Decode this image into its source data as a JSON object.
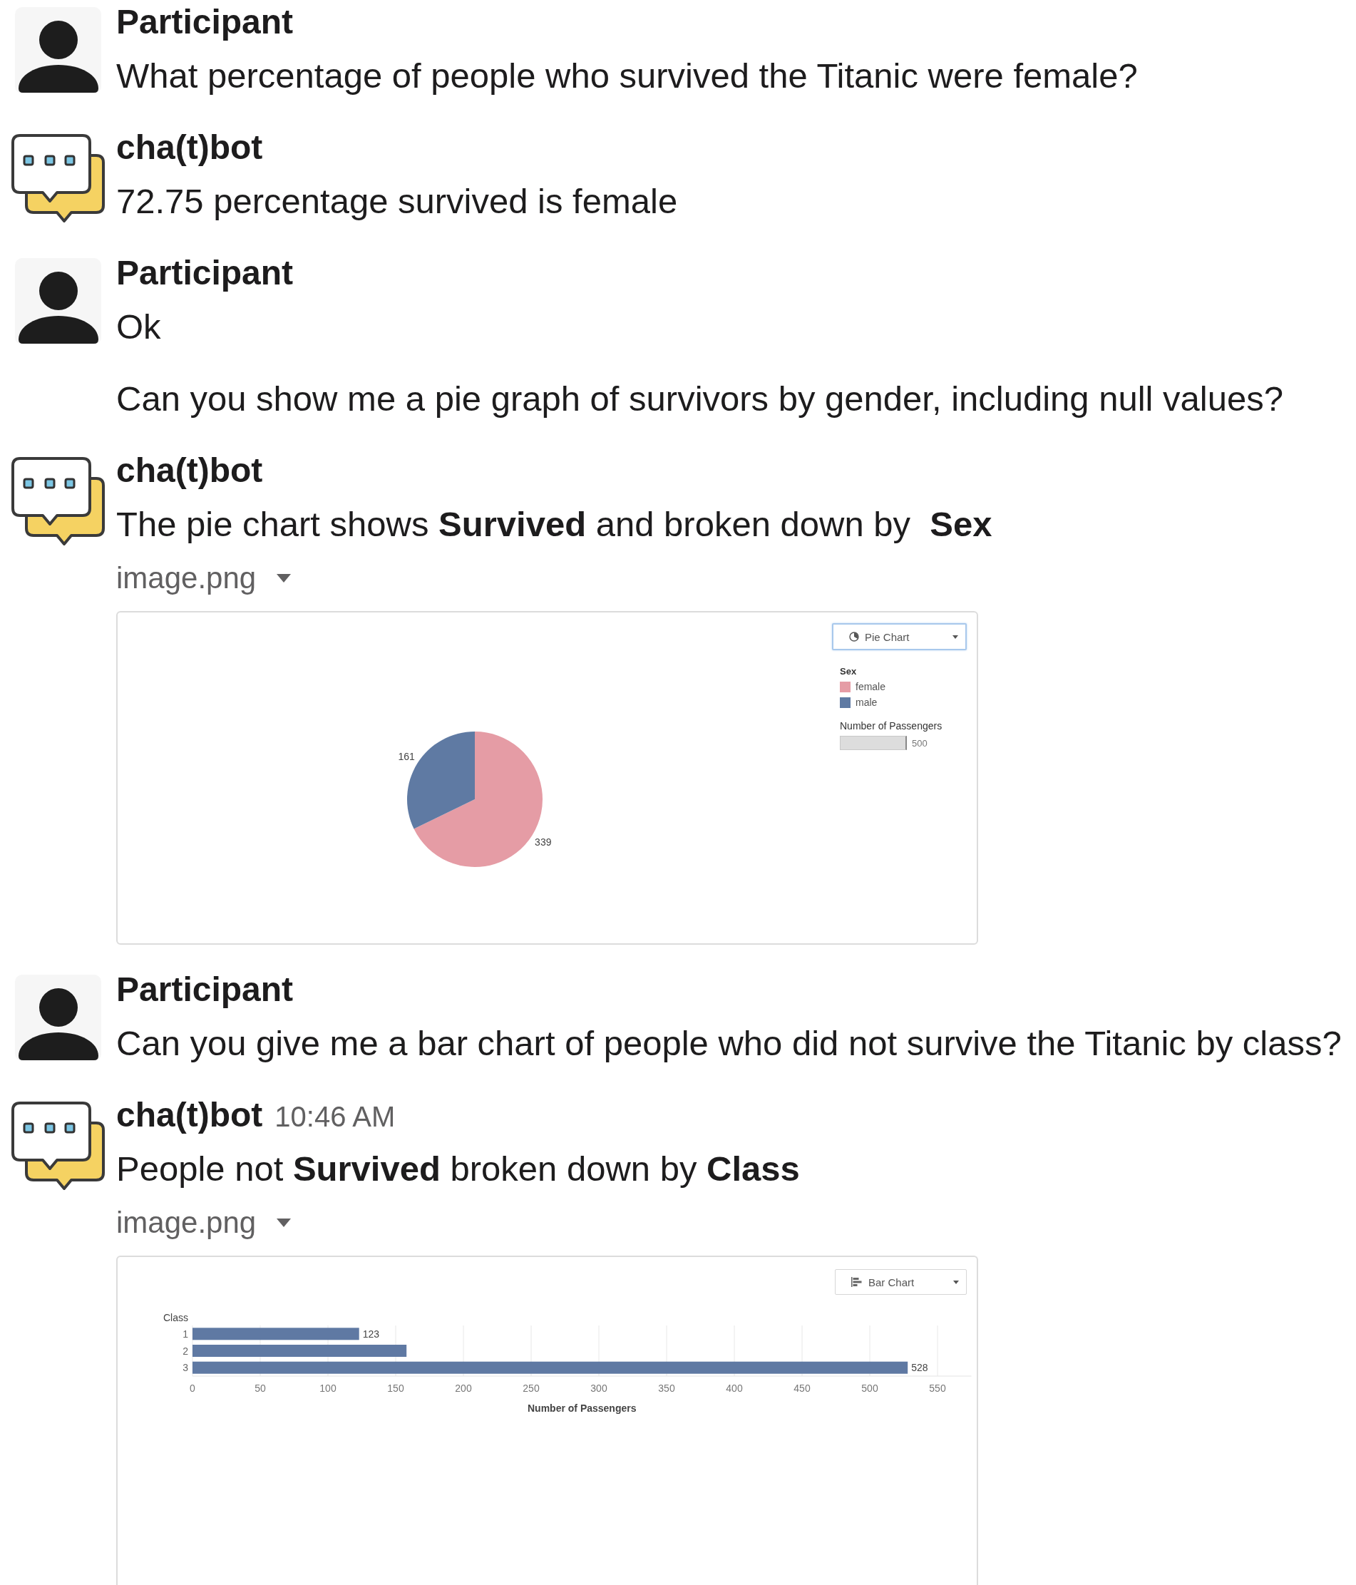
{
  "messages": [
    {
      "kind": "user",
      "author": "Participant",
      "paragraphs": [
        "What percentage of people who survived the Titanic were female?"
      ]
    },
    {
      "kind": "bot",
      "author": "cha(t)bot",
      "paragraphs": [
        "72.75 percentage survived is female"
      ]
    },
    {
      "kind": "user",
      "author": "Participant",
      "paragraphs": [
        "Ok",
        "Can you show me a pie graph of survivors by gender, including null values?"
      ]
    },
    {
      "kind": "bot",
      "author": "cha(t)bot",
      "paragraphs": [
        "The pie chart shows **Survived** and broken down by  **Sex**"
      ],
      "attachment": {
        "filename": "image.png",
        "view_selector": {
          "label": "Pie Chart",
          "focused": true
        },
        "legend": {
          "title": "Sex",
          "items": [
            {
              "color": "#e59ca5"
            },
            {
              "color": "#5f7aa3"
            }
          ]
        },
        "size_legend": {
          "title": "Number of Passengers",
          "label": "500"
        },
        "chart_data": {
          "type": "pie",
          "categories": [
            "female",
            "male"
          ],
          "values": [
            339,
            161
          ],
          "data_labels": true
        }
      }
    },
    {
      "kind": "user",
      "author": "Participant",
      "paragraphs": [
        "Can you give me a bar chart of people who did not survive the Titanic by class?"
      ]
    },
    {
      "kind": "bot",
      "author": "cha(t)bot",
      "time": "10:46 AM",
      "paragraphs": [
        "People not **Survived** broken down by **Class**"
      ],
      "attachment": {
        "filename": "image.png",
        "view_selector": {
          "label": "Bar Chart",
          "focused": false
        },
        "chart_data": {
          "type": "bar",
          "orientation": "horizontal",
          "xlabel": "Number of Passengers",
          "ylabel": "Class",
          "categories": [
            "1",
            "2",
            "3"
          ],
          "series": [
            {
              "color": "#5f79a3",
              "values": [
                123,
                158,
                528
              ]
            }
          ],
          "xlim": [
            0,
            575
          ],
          "xticks": [
            0,
            50,
            100,
            150,
            200,
            250,
            300,
            350,
            400,
            450,
            500,
            550
          ],
          "grid": true,
          "value_labels": [
            "123",
            null,
            "528"
          ]
        }
      }
    }
  ]
}
